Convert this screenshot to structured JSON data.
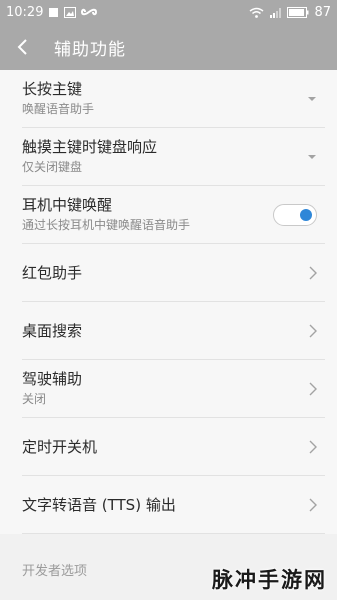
{
  "status_bar": {
    "time": "10:29",
    "battery": "87",
    "icons": [
      "notification-square-icon",
      "image-icon",
      "infinity-icon",
      "wifi-icon",
      "signal-icon",
      "battery-icon"
    ]
  },
  "header": {
    "back_icon": "chevron-left-icon",
    "title": "辅助功能"
  },
  "items": [
    {
      "title": "长按主键",
      "subtitle": "唤醒语音助手",
      "control": "dropdown"
    },
    {
      "title": "触摸主键时键盘响应",
      "subtitle": "仅关闭键盘",
      "control": "dropdown"
    },
    {
      "title": "耳机中键唤醒",
      "subtitle": "通过长按耳机中键唤醒语音助手",
      "control": "toggle",
      "toggle_on": true
    },
    {
      "title": "红包助手",
      "subtitle": "",
      "control": "chevron"
    },
    {
      "title": "桌面搜索",
      "subtitle": "",
      "control": "chevron"
    },
    {
      "title": "驾驶辅助",
      "subtitle": "关闭",
      "control": "chevron"
    },
    {
      "title": "定时开关机",
      "subtitle": "",
      "control": "chevron"
    },
    {
      "title": "文字转语音 (TTS) 输出",
      "subtitle": "",
      "control": "chevron"
    }
  ],
  "section": {
    "label": "开发者选项"
  },
  "watermark": "脉冲手游网",
  "colors": {
    "header_bg": "#a9a9a9",
    "accent": "#2f87d8",
    "list_bg": "#f7f7f7"
  }
}
